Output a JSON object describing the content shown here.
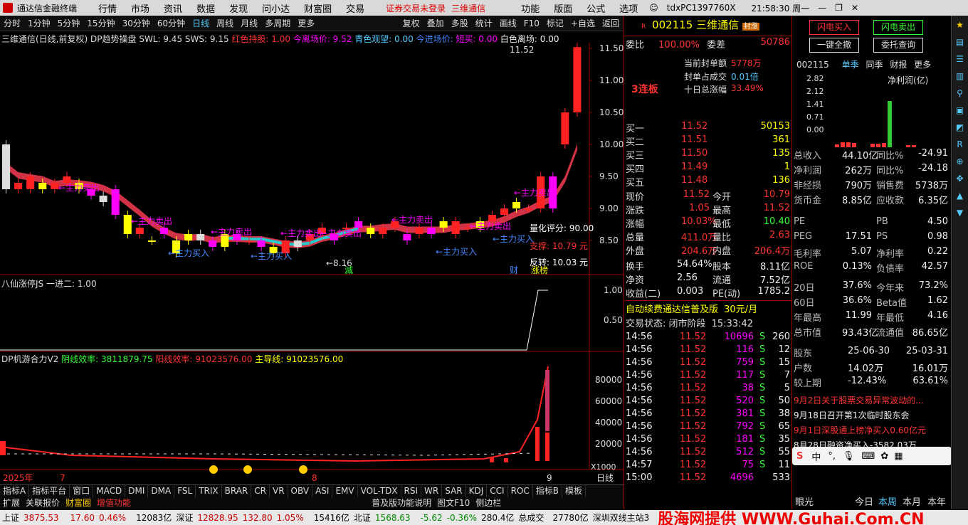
{
  "app": {
    "title": "通达信金融终端",
    "menu": [
      "行情",
      "市场",
      "资讯",
      "数据",
      "发现",
      "问小达",
      "财富圈",
      "交易"
    ],
    "notice1": "证券交易未登录",
    "notice2": "三维通信",
    "menu_right": [
      "功能",
      "版面",
      "公式",
      "选项"
    ],
    "account": "tdxPC1397760X",
    "clock": "21:58:30 周一"
  },
  "toolbar": {
    "periods": [
      "分时",
      "1分钟",
      "5分钟",
      "15分钟",
      "30分钟",
      "60分钟",
      "日线",
      "周线",
      "月线",
      "多周期",
      "更多"
    ],
    "selected": "日线",
    "actions": [
      "复权",
      "叠加",
      "多股",
      "统计",
      "画线",
      "F10",
      "标记",
      "+自选",
      "返回"
    ]
  },
  "main_chart": {
    "legend": {
      "name": "三维通信(日线,前复权)",
      "ind": "DP趋势操盘",
      "swl": "SWL: 9.45",
      "sws": "SWS: 9.15",
      "hold": "红色持股: 1.00",
      "dist": "今离场价: 9.52",
      "watch": "青色观望: 0.00",
      "enter": "今进场价:",
      "short": "短买: 0.00",
      "white": "白色离场: 0.00"
    },
    "yticks": [
      "11.50",
      "11.00",
      "10.50",
      "10.00",
      "9.50",
      "9.00",
      "8.50"
    ],
    "labels": {
      "sell": "←主力卖出",
      "buy": "←主力买入",
      "low": "←8.16",
      "quant": "量化评分: 90.00",
      "support": "支撑: 10.79 元",
      "reverse": "反转: 10.03 元",
      "high": "11.52",
      "jian": "減",
      "cai": "财",
      "zhang": "涨榜"
    }
  },
  "ind1": {
    "legend": "八仙涨停JS",
    "val": "一进二: 1.00",
    "yticks": [
      "1.00",
      "0.50"
    ]
  },
  "ind2": {
    "legend": "DP机游合力V2",
    "yin": "阴线效率: 3811879.75",
    "yang": "阳线效率: 91023576.00",
    "main": "主导线: 91023576.00",
    "yticks": [
      "80000",
      "60000",
      "40000",
      "20000"
    ],
    "x1000": "X1000"
  },
  "xaxis": {
    "year": "2025年",
    "m7": "7",
    "m8": "8",
    "m9": "9",
    "period": "日线"
  },
  "chart_data": {
    "type": "candlestick",
    "open": [
      10.0,
      9.3,
      9.3,
      9.3,
      9.3,
      9.4,
      9.4,
      9.3,
      9.2,
      9.3,
      8.9,
      8.6,
      8.5,
      8.7,
      8.5,
      8.5,
      8.6,
      8.5,
      8.4,
      8.6,
      8.5,
      8.5,
      8.4,
      8.3,
      8.5,
      8.5,
      8.6,
      8.6,
      8.7,
      8.8,
      8.7,
      8.6,
      8.7,
      8.6,
      8.6,
      8.7,
      8.7,
      8.6,
      8.7,
      8.7,
      8.8,
      8.9,
      9.0,
      9.0,
      9.0,
      9.5,
      10.0,
      10.5
    ],
    "close": [
      9.3,
      9.4,
      9.5,
      9.4,
      9.4,
      9.5,
      9.3,
      9.2,
      9.1,
      8.9,
      8.6,
      8.7,
      8.5,
      8.6,
      8.3,
      8.6,
      8.5,
      8.4,
      8.6,
      8.5,
      8.5,
      8.4,
      8.3,
      8.5,
      8.4,
      8.6,
      8.7,
      8.5,
      8.7,
      8.7,
      8.6,
      8.7,
      8.8,
      8.5,
      8.7,
      8.6,
      8.8,
      8.8,
      8.7,
      8.8,
      8.9,
      9.0,
      9.1,
      9.0,
      9.5,
      9.0,
      10.5,
      11.52
    ]
  },
  "quote": {
    "code": "002115",
    "name": "三维通信",
    "tag": "封涨",
    "weibi": "委比",
    "weibi_v": "100.00%",
    "weicha": "委差",
    "weicha_v": "50786",
    "lianban": "3连板",
    "fengdan": "当前封单额",
    "fengdan_v": "5778万",
    "zhanbi": "封单占成交",
    "zhanbi_v": "0.01倍",
    "shiri": "十日总涨幅",
    "shiri_v": "33.49%",
    "buy": [
      [
        "买一",
        "11.52",
        "50153"
      ],
      [
        "买二",
        "11.51",
        "361"
      ],
      [
        "买三",
        "11.50",
        "135"
      ],
      [
        "买四",
        "11.49",
        "1"
      ],
      [
        "买五",
        "11.48",
        "136"
      ]
    ],
    "stats": [
      [
        "现价",
        "11.52",
        "今开",
        "10.79"
      ],
      [
        "涨跌",
        "1.05",
        "最高",
        "11.52"
      ],
      [
        "涨幅",
        "10.03%",
        "最低",
        "10.40"
      ],
      [
        "总量",
        "411.0万",
        "量比",
        "2.63"
      ],
      [
        "外盘",
        "204.6万",
        "内盘",
        "206.4万"
      ]
    ],
    "stats2": [
      [
        "换手",
        "54.64%",
        "股本",
        "8.11亿"
      ],
      [
        "净资",
        "2.56",
        "流通",
        "7.52亿"
      ],
      [
        "收益(二)",
        "0.003",
        "PE(动)",
        "1785.2"
      ]
    ],
    "ad": "自动续费通达信普及版",
    "ad_price": "30元/月",
    "state": "交易状态: 闭市阶段",
    "state_time": "15:33:42"
  },
  "ticks": [
    [
      "14:56",
      "11.52",
      "10696",
      "S",
      "260"
    ],
    [
      "14:56",
      "11.52",
      "116",
      "S",
      "12"
    ],
    [
      "14:56",
      "11.52",
      "759",
      "S",
      "15"
    ],
    [
      "14:56",
      "11.52",
      "117",
      "S",
      "7"
    ],
    [
      "14:56",
      "11.52",
      "38",
      "S",
      "5"
    ],
    [
      "14:56",
      "11.52",
      "520",
      "S",
      "50"
    ],
    [
      "14:56",
      "11.52",
      "381",
      "S",
      "38"
    ],
    [
      "14:56",
      "11.52",
      "792",
      "S",
      "65"
    ],
    [
      "14:56",
      "11.52",
      "181",
      "S",
      "35"
    ],
    [
      "14:56",
      "11.52",
      "512",
      "S",
      "55"
    ],
    [
      "14:57",
      "11.52",
      "75",
      "S",
      "11"
    ],
    [
      "15:00",
      "11.52",
      "4696",
      "",
      "533"
    ]
  ],
  "right2": {
    "btn_buy": "闪电买入",
    "btn_sell": "闪电卖出",
    "btn_cancel": "一键全撤",
    "btn_query": "委托查询",
    "code": "002115",
    "tabs": [
      "单季",
      "同季",
      "财报",
      "更多"
    ],
    "profit": "净利润(亿)",
    "yticks": [
      "2.82",
      "2.12",
      "1.41",
      "0.71",
      "0.00"
    ],
    "years": [
      "2023",
      "2024",
      "2025"
    ],
    "fin": [
      [
        "总收入",
        "44.10亿",
        "同比%",
        "-24.91"
      ],
      [
        "净利润",
        "262万",
        "同比%",
        "-24.18"
      ],
      [
        "非经损",
        "790万",
        "销售费",
        "5738万"
      ],
      [
        "货币金",
        "8.85亿",
        "应收款",
        "6.35亿"
      ]
    ],
    "val": [
      [
        "PE",
        "",
        "PB",
        "4.50"
      ],
      [
        "PEG",
        "17.51",
        "PS",
        "0.98"
      ],
      [
        "毛利率",
        "5.07",
        "净利率",
        "0.22"
      ],
      [
        "ROE",
        "0.13%",
        "负债率",
        "42.57"
      ]
    ],
    "perf": [
      [
        "20日",
        "37.6%",
        "今年来",
        "73.2%"
      ],
      [
        "60日",
        "36.6%",
        "Beta值",
        "1.62"
      ],
      [
        "年最高",
        "11.99",
        "年最低",
        "4.16"
      ],
      [
        "总市值",
        "93.43亿",
        "流通值",
        "86.65亿"
      ]
    ],
    "holders": [
      [
        "股东",
        "25-06-30",
        "25-03-31"
      ],
      [
        "户数",
        "14.02万",
        "16.01万"
      ],
      [
        "较上期",
        "-12.43%",
        "63.61%"
      ]
    ],
    "news": [
      "9月2日关于股票交易异常波动的...",
      "9月18日召开第1次临时股东会",
      "9月1日深股通上榜净买入0.60亿元",
      "8月28日融资净买入-3582.03万",
      "08-29涨停:卫星通信+5G专网+海..."
    ],
    "bottom": [
      "眼光",
      "今日",
      "本周",
      "本月",
      "本年"
    ],
    "ime": "中"
  },
  "btabs": [
    "指标A",
    "指标平台",
    "窗口",
    "MACD",
    "DMI",
    "DMA",
    "FSL",
    "TRIX",
    "BRAR",
    "CR",
    "VR",
    "OBV",
    "ASI",
    "EMV",
    "VOL-TDX",
    "RSI",
    "WR",
    "SAR",
    "KDJ",
    "CCI",
    "ROC",
    "指标B",
    "模板"
  ],
  "btabs2": [
    "扩展",
    "关联报价",
    "财富圈",
    "增值功能",
    "普及版功能说明",
    "图文F10",
    "侧边栏"
  ],
  "status": {
    "sh": "上证",
    "sh_v": "3875.53",
    "sh_c": "17.60",
    "sh_p": "0.46%",
    "sh_a": "12083亿",
    "sz": "深证",
    "sz_v": "12828.95",
    "sz_c": "132.80",
    "sz_p": "1.05%",
    "sz_a": "15416亿",
    "bz": "北证",
    "bz_v": "1568.63",
    "bz_c": "-5.62",
    "bz_p": "-0.36%",
    "bz_a": "280.4亿",
    "total": "总成交",
    "total_v": "27780亿",
    "site": "深圳双线主站3",
    "watermark": "股海网提供 WWW.Guhai.Com.CN"
  }
}
